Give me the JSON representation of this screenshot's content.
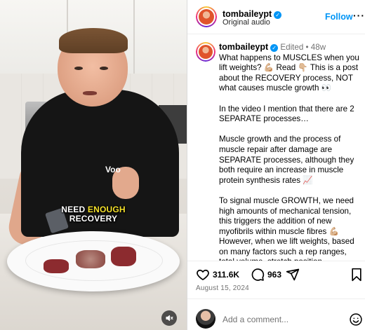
{
  "video": {
    "caption_line1_a": "NEED ",
    "caption_line1_b": "ENOUGH",
    "caption_line2": "RECOVERY",
    "shirt_logo": "Voo",
    "mute_icon": "speaker-muted-icon"
  },
  "header": {
    "username": "tombaileypt",
    "audio": "Original audio",
    "follow_label": "Follow",
    "more_label": "···"
  },
  "post": {
    "username": "tombaileypt",
    "edited": "Edited",
    "separator": "•",
    "age": "48w",
    "paragraphs": [
      "What happens to MUSCLES when you lift weights? 💪🏼 Read 👇🏼 This is a post about the RECOVERY process, NOT what causes muscle growth 👀",
      "In the video I mention that there are 2 SEPARATE processes…",
      "Muscle growth and the process of muscle repair after damage are SEPARATE processes, although they both require an increase in muscle protein synthesis rates 📈",
      "To signal muscle GROWTH, we need high amounts of mechanical tension, this triggers the addition of new myofibrils within muscle fibres 💪🏼 However, when we lift weights, based on many factors such a rep ranges, total volume, stretch position"
    ]
  },
  "actions": {
    "likes": "311.6K",
    "comments": "963",
    "date": "August 15, 2024"
  },
  "comment_box": {
    "placeholder": "Add a comment..."
  },
  "colors": {
    "accent": "#0095f6",
    "caption_highlight": "#f5e12b"
  }
}
